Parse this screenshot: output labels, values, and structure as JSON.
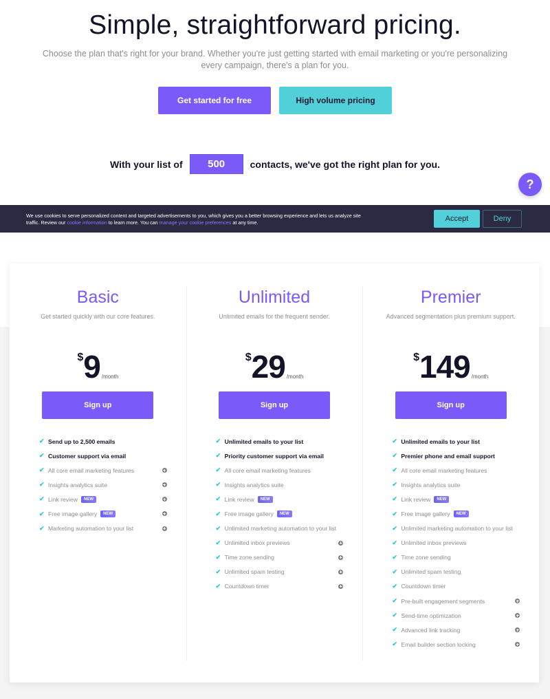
{
  "hero": {
    "title": "Simple, straightforward pricing.",
    "subtitle": "Choose the plan that's right for your brand. Whether you're just getting started with email marketing or you're personalizing every campaign, there's a plan for you.",
    "primary_button": "Get started for free",
    "secondary_button": "High volume pricing"
  },
  "contacts": {
    "prefix": "With your list of",
    "value": "500",
    "suffix": "contacts, we've got the right plan for you."
  },
  "help": {
    "icon": "question-icon",
    "label": "?"
  },
  "cookie_banner": {
    "text_part1": "We use cookies to serve personalized content and targeted advertisements to you, which gives you a better browsing experience and lets us analyze site traffic. Review our ",
    "link1": "cookie information",
    "text_part2": " to learn more. You can ",
    "link2": "manage your cookie preferences",
    "text_part3": " at any time.",
    "accept": "Accept",
    "deny": "Deny"
  },
  "colors": {
    "brand_purple": "#7a5af8",
    "teal": "#52d0da",
    "dark_navy": "#2a2a42"
  },
  "plans": [
    {
      "name": "Basic",
      "description": "Get started quickly with our core features.",
      "currency": "$",
      "price": "9",
      "period": "/month",
      "cta": "Sign up",
      "features": [
        {
          "label": "Send up to 2,500 emails",
          "bold": true,
          "badge": "",
          "info": false
        },
        {
          "label": "Customer support via email",
          "bold": true,
          "badge": "",
          "info": false
        },
        {
          "label": "All core email marketing features",
          "bold": false,
          "badge": "",
          "info": true
        },
        {
          "label": "Insights analytics suite",
          "bold": false,
          "badge": "",
          "info": true
        },
        {
          "label": "Link review",
          "bold": false,
          "badge": "NEW",
          "info": true
        },
        {
          "label": "Free image gallery",
          "bold": false,
          "badge": "NEW",
          "info": true
        },
        {
          "label": "Marketing automation to your list",
          "bold": false,
          "badge": "",
          "info": true
        }
      ]
    },
    {
      "name": "Unlimited",
      "description": "Unlimited emails for the frequent sender.",
      "currency": "$",
      "price": "29",
      "period": "/month",
      "cta": "Sign up",
      "features": [
        {
          "label": "Unlimited emails to your list",
          "bold": true,
          "badge": "",
          "info": false
        },
        {
          "label": "Priority customer support via email",
          "bold": true,
          "badge": "",
          "info": false
        },
        {
          "label": "All core email marketing features",
          "bold": false,
          "badge": "",
          "info": false
        },
        {
          "label": "Insights analytics suite",
          "bold": false,
          "badge": "",
          "info": false
        },
        {
          "label": "Link review",
          "bold": false,
          "badge": "NEW",
          "info": false
        },
        {
          "label": "Free image gallery",
          "bold": false,
          "badge": "NEW",
          "info": false
        },
        {
          "label": "Unlimited marketing automation to your list",
          "bold": false,
          "badge": "",
          "info": false
        },
        {
          "label": "Unlimited inbox previews",
          "bold": false,
          "badge": "",
          "info": true
        },
        {
          "label": "Time zone sending",
          "bold": false,
          "badge": "",
          "info": true
        },
        {
          "label": "Unlimited spam testing",
          "bold": false,
          "badge": "",
          "info": true
        },
        {
          "label": "Countdown timer",
          "bold": false,
          "badge": "",
          "info": true
        }
      ]
    },
    {
      "name": "Premier",
      "description": "Advanced segmentation plus premium support.",
      "currency": "$",
      "price": "149",
      "period": "/month",
      "cta": "Sign up",
      "features": [
        {
          "label": "Unlimited emails to your list",
          "bold": true,
          "badge": "",
          "info": false
        },
        {
          "label": "Premier phone and email support",
          "bold": true,
          "badge": "",
          "info": false
        },
        {
          "label": "All core email marketing features",
          "bold": false,
          "badge": "",
          "info": false
        },
        {
          "label": "Insights analytics suite",
          "bold": false,
          "badge": "",
          "info": false
        },
        {
          "label": "Link review",
          "bold": false,
          "badge": "NEW",
          "info": false
        },
        {
          "label": "Free image gallery",
          "bold": false,
          "badge": "NEW",
          "info": false
        },
        {
          "label": "Unlimited marketing automation to your list",
          "bold": false,
          "badge": "",
          "info": false
        },
        {
          "label": "Unlimited inbox previews",
          "bold": false,
          "badge": "",
          "info": false
        },
        {
          "label": "Time zone sending",
          "bold": false,
          "badge": "",
          "info": false
        },
        {
          "label": "Unlimited spam testing",
          "bold": false,
          "badge": "",
          "info": false
        },
        {
          "label": "Countdown timer",
          "bold": false,
          "badge": "",
          "info": false
        },
        {
          "label": "Pre-built engagement segments",
          "bold": false,
          "badge": "",
          "info": true
        },
        {
          "label": "Send-time optimization",
          "bold": false,
          "badge": "",
          "info": true
        },
        {
          "label": "Advanced link tracking",
          "bold": false,
          "badge": "",
          "info": true
        },
        {
          "label": "Email builder section locking",
          "bold": false,
          "badge": "",
          "info": true
        }
      ]
    }
  ]
}
